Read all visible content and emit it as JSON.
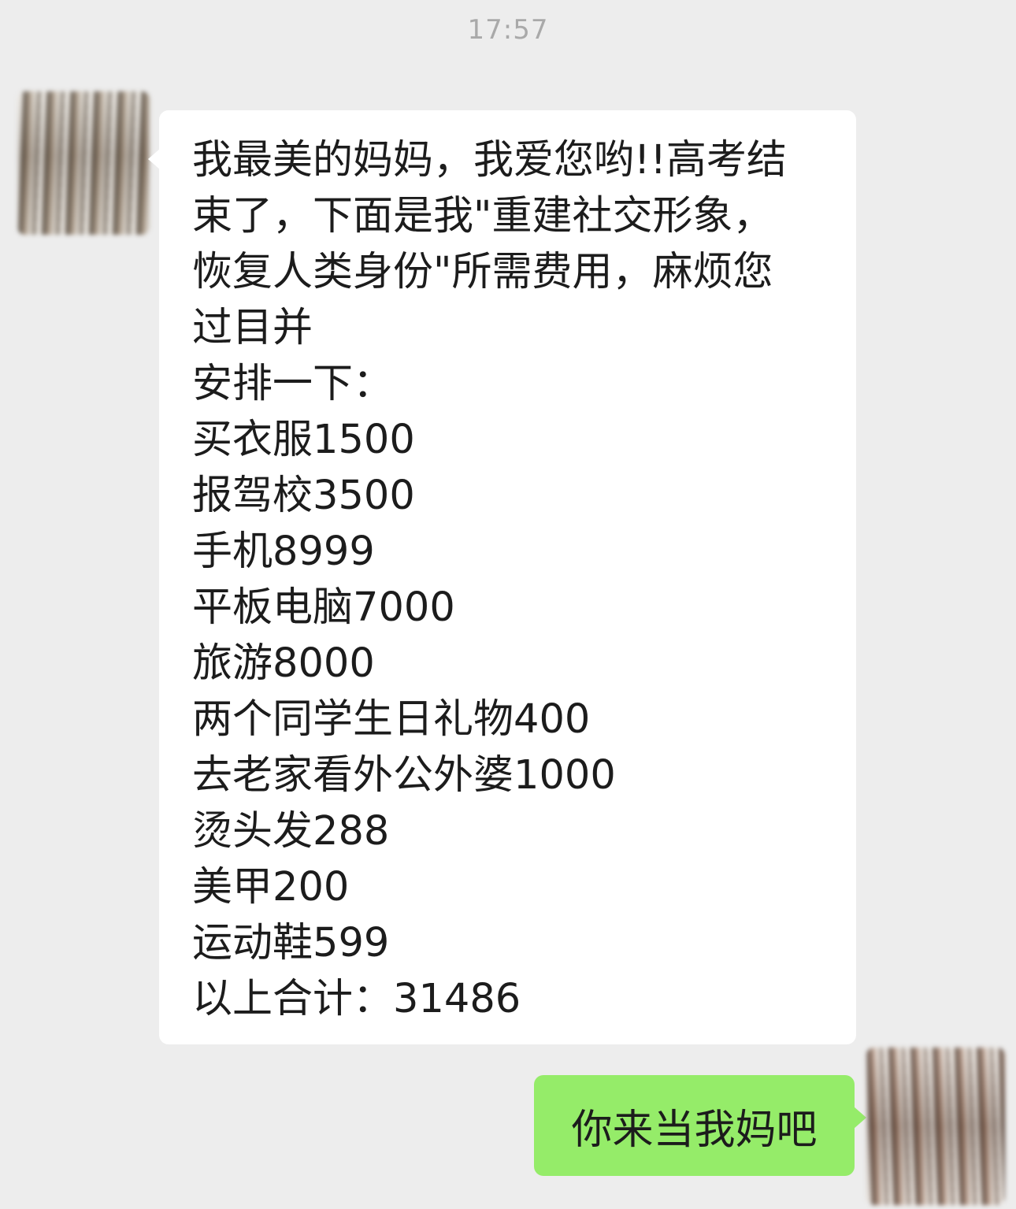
{
  "chat": {
    "timestamp": "17:57",
    "incoming": {
      "avatar_icon": "user-avatar-icon",
      "lines": [
        "我最美的妈妈，我爱您哟!!高考结",
        "束了，下面是我\"重建社交形象，",
        "恢复人类身份\"所需费用，麻烦您",
        "过目并",
        "安排一下：",
        "买衣服1500",
        "报驾校3500",
        "手机8999",
        "平板电脑7000",
        "旅游8000",
        "两个同学生日礼物400",
        "去老家看外公外婆1000",
        "烫头发288",
        "美甲200",
        "运动鞋599",
        "以上合计：31486"
      ]
    },
    "outgoing": {
      "avatar_icon": "self-avatar-icon",
      "text": "你来当我妈吧",
      "bubble_color": "#95ec69"
    },
    "background_color": "#ededed"
  }
}
